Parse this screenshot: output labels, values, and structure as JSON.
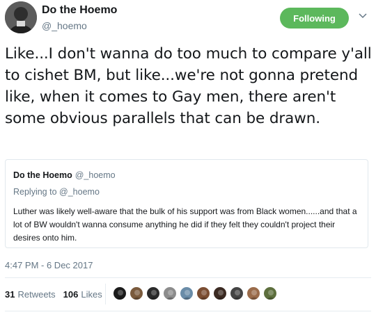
{
  "author": {
    "name": "Do the Hoemo",
    "handle": "@_hoemo"
  },
  "follow_button": {
    "label": "Following",
    "color": "#5cb85c"
  },
  "tweet_text": "Like...I don't wanna do too much to compare y'all to cishet BM, but like...we're not gonna pretend like, when it comes to Gay men, there aren't some obvious parallels that can be drawn.",
  "quoted_tweet": {
    "name": "Do the Hoemo",
    "handle": "@_hoemo",
    "replying_prefix": "Replying to",
    "replying_handle": "@_hoemo",
    "text": "Luther was likely well-aware that the bulk of his support was from Black women......and that a lot of BW wouldn't wanna consume anything he did if they felt they couldn't project their desires onto him."
  },
  "timestamp": "4:47 PM - 6 Dec 2017",
  "stats": {
    "retweets_count": "31",
    "retweets_label": "Retweets",
    "likes_count": "106",
    "likes_label": "Likes"
  },
  "liker_avatars": [
    {
      "icon": "avatar-1",
      "color": "#1b1b1b"
    },
    {
      "icon": "avatar-2",
      "color": "#7a5a3c"
    },
    {
      "icon": "avatar-3",
      "color": "#2a2a2a"
    },
    {
      "icon": "avatar-4",
      "color": "#8c8c8c"
    },
    {
      "icon": "avatar-5",
      "color": "#6a8ca8"
    },
    {
      "icon": "avatar-6",
      "color": "#7b4d32"
    },
    {
      "icon": "avatar-7",
      "color": "#3b2a22"
    },
    {
      "icon": "avatar-8",
      "color": "#444444"
    },
    {
      "icon": "avatar-9",
      "color": "#9a6b4a"
    },
    {
      "icon": "avatar-10",
      "color": "#5d6f3d"
    }
  ]
}
